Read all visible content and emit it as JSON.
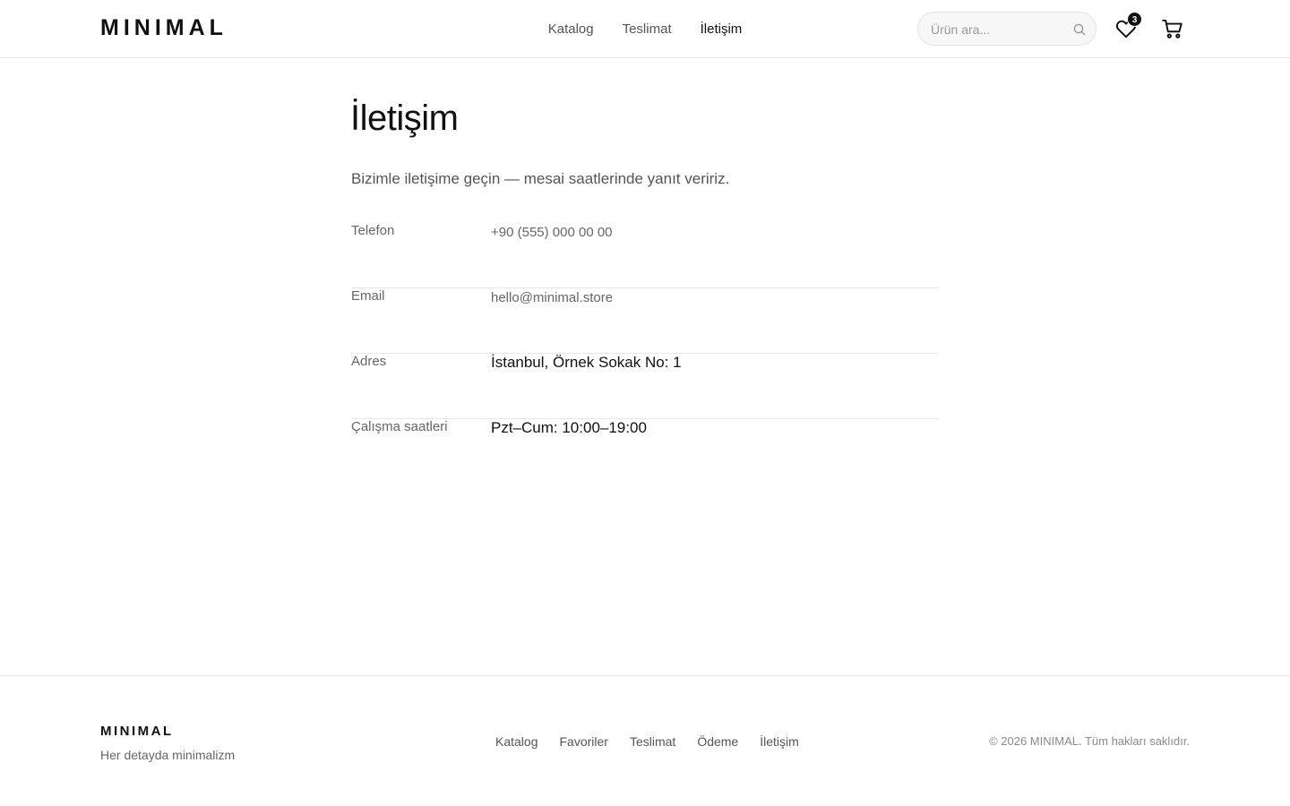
{
  "brand": {
    "name": "MINIMAL"
  },
  "nav": {
    "items": [
      {
        "label": "Katalog"
      },
      {
        "label": "Teslimat"
      },
      {
        "label": "İletişim"
      }
    ]
  },
  "search": {
    "placeholder": "Ürün ara...",
    "value": ""
  },
  "favorites": {
    "count": "3"
  },
  "page": {
    "title": "İletişim",
    "subtitle": "Bizimle iletişime geçin — mesai saatlerinde yanıt veririz.",
    "contact": [
      {
        "label": "Telefon",
        "value": "+90 (555) 000 00 00"
      },
      {
        "label": "Email",
        "value": "hello@minimal.store"
      },
      {
        "label": "Adres",
        "value": "İstanbul, Örnek Sokak No: 1"
      },
      {
        "label": "Çalışma saatleri",
        "value": "Pzt–Cum: 10:00–19:00"
      }
    ]
  },
  "footer": {
    "brand": "MINIMAL",
    "tagline": "Her detayda minimalizm",
    "links": [
      {
        "label": "Katalog"
      },
      {
        "label": "Favoriler"
      },
      {
        "label": "Teslimat"
      },
      {
        "label": "Ödeme"
      },
      {
        "label": "İletişim"
      }
    ],
    "copyright": "© 2026 MINIMAL. Tüm hakları saklıdır."
  }
}
